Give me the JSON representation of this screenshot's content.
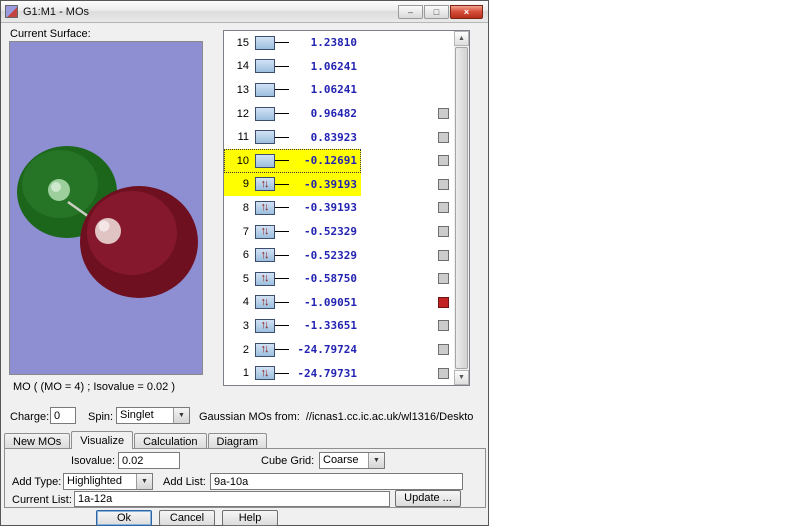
{
  "window": {
    "title": "G1:M1 - MOs",
    "controls": {
      "minimize": "–",
      "maximize": "□",
      "close": "×"
    }
  },
  "surface": {
    "label": "Current Surface:",
    "caption": "MO ( (MO = 4) ; Isovalue = 0.02 )"
  },
  "mo_list": {
    "rows": [
      {
        "index": "15",
        "energy": "1.23810",
        "occupied": false,
        "highlighted": false,
        "focused": false,
        "has_checkbox": false,
        "checked": false
      },
      {
        "index": "14",
        "energy": "1.06241",
        "occupied": false,
        "highlighted": false,
        "focused": false,
        "has_checkbox": false,
        "checked": false
      },
      {
        "index": "13",
        "energy": "1.06241",
        "occupied": false,
        "highlighted": false,
        "focused": false,
        "has_checkbox": false,
        "checked": false
      },
      {
        "index": "12",
        "energy": "0.96482",
        "occupied": false,
        "highlighted": false,
        "focused": false,
        "has_checkbox": true,
        "checked": false
      },
      {
        "index": "11",
        "energy": "0.83923",
        "occupied": false,
        "highlighted": false,
        "focused": false,
        "has_checkbox": true,
        "checked": false
      },
      {
        "index": "10",
        "energy": "-0.12691",
        "occupied": false,
        "highlighted": true,
        "focused": true,
        "has_checkbox": true,
        "checked": false
      },
      {
        "index": "9",
        "energy": "-0.39193",
        "occupied": true,
        "highlighted": true,
        "focused": false,
        "has_checkbox": true,
        "checked": false
      },
      {
        "index": "8",
        "energy": "-0.39193",
        "occupied": true,
        "highlighted": false,
        "focused": false,
        "has_checkbox": true,
        "checked": false
      },
      {
        "index": "7",
        "energy": "-0.52329",
        "occupied": true,
        "highlighted": false,
        "focused": false,
        "has_checkbox": true,
        "checked": false
      },
      {
        "index": "6",
        "energy": "-0.52329",
        "occupied": true,
        "highlighted": false,
        "focused": false,
        "has_checkbox": true,
        "checked": false
      },
      {
        "index": "5",
        "energy": "-0.58750",
        "occupied": true,
        "highlighted": false,
        "focused": false,
        "has_checkbox": true,
        "checked": false
      },
      {
        "index": "4",
        "energy": "-1.09051",
        "occupied": true,
        "highlighted": false,
        "focused": false,
        "has_checkbox": true,
        "checked": true
      },
      {
        "index": "3",
        "energy": "-1.33651",
        "occupied": true,
        "highlighted": false,
        "focused": false,
        "has_checkbox": true,
        "checked": false
      },
      {
        "index": "2",
        "energy": "-24.79724",
        "occupied": true,
        "highlighted": false,
        "focused": false,
        "has_checkbox": true,
        "checked": false
      },
      {
        "index": "1",
        "energy": "-24.79731",
        "occupied": true,
        "highlighted": false,
        "focused": false,
        "has_checkbox": true,
        "checked": false
      }
    ]
  },
  "charge_row": {
    "charge_label": "Charge:",
    "charge_value": "0",
    "spin_label": "Spin:",
    "spin_value": "Singlet",
    "source_label": "Gaussian MOs from:",
    "source_path": "//icnas1.cc.ic.ac.uk/wl1316/Deskto"
  },
  "tabs": [
    {
      "label": "New MOs"
    },
    {
      "label": "Visualize"
    },
    {
      "label": "Calculation"
    },
    {
      "label": "Diagram"
    }
  ],
  "visualize_tab": {
    "isovalue_label": "Isovalue:",
    "isovalue_value": "0.02",
    "cube_grid_label": "Cube Grid:",
    "cube_grid_value": "Coarse",
    "add_type_label": "Add Type:",
    "add_type_value": "Highlighted",
    "add_list_label": "Add List:",
    "add_list_value": "9a-10a",
    "current_list_label": "Current List:",
    "current_list_value": "1a-12a",
    "update_button": "Update ..."
  },
  "footer": {
    "ok": "Ok",
    "cancel": "Cancel",
    "help": "Help"
  },
  "colors": {
    "highlight_row": "#ffff00",
    "energy_text": "#2323b2",
    "checked_checkbox": "#c22424",
    "viewport_bg": "#8e8ed2",
    "lobe_positive": "#1c661c",
    "lobe_negative": "#6e1020"
  }
}
